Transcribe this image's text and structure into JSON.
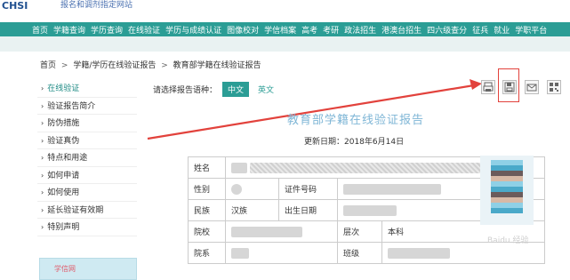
{
  "header": {
    "logo_text": "CHSI",
    "top_line_1": "",
    "top_line_2": "报名和调剂指定网站"
  },
  "nav": {
    "items": [
      "首页",
      "学籍查询",
      "学历查询",
      "在线验证",
      "学历与成绩认证",
      "图像校对",
      "学信档案",
      "高考",
      "考研",
      "政法招生",
      "港澳台招生",
      "四六级查分",
      "征兵",
      "就业",
      "学职平台"
    ]
  },
  "breadcrumb": {
    "items": [
      "首页",
      "学籍/学历在线验证报告",
      "教育部学籍在线验证报告"
    ]
  },
  "sidebar": {
    "items": [
      {
        "label": "在线验证",
        "active": true
      },
      {
        "label": "验证报告简介",
        "active": false
      },
      {
        "label": "防伪措施",
        "active": false
      },
      {
        "label": "验证真伪",
        "active": false
      },
      {
        "label": "特点和用途",
        "active": false
      },
      {
        "label": "如何申请",
        "active": false
      },
      {
        "label": "如何使用",
        "active": false
      },
      {
        "label": "延长验证有效期",
        "active": false
      },
      {
        "label": "特别声明",
        "active": false
      }
    ],
    "promo_text": "学信网"
  },
  "language": {
    "prompt": "请选择报告语种：",
    "options": [
      "中文",
      "英文"
    ],
    "selected": "中文"
  },
  "tools": {
    "icons": [
      "print-icon",
      "save-icon",
      "email-icon",
      "qrcode-icon"
    ]
  },
  "report": {
    "title": "教育部学籍在线验证报告",
    "update_date": "更新日期：2018年6月14日",
    "labels": {
      "name": "姓名",
      "gender": "性别",
      "id_no": "证件号码",
      "ethnicity": "民族",
      "birth": "出生日期",
      "school": "院校",
      "level": "层次",
      "dept": "院系",
      "class": "班级"
    },
    "values": {
      "ethnicity": "汉族",
      "level": "本科"
    }
  },
  "watermark": "Baidu 经验"
}
